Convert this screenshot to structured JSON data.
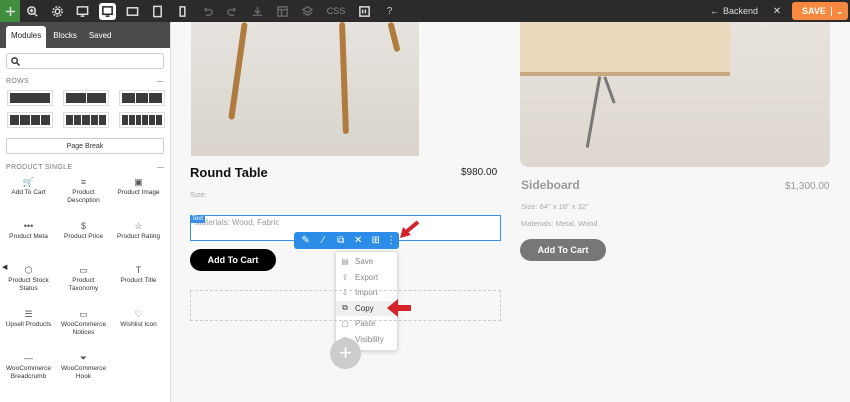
{
  "toolbar": {
    "icons": [
      "plus-icon",
      "zoom-icon",
      "gear-icon",
      "desktop-icon",
      "desktop-view-icon",
      "tablet-landscape-icon",
      "tablet-icon",
      "phone-icon",
      "undo-icon",
      "redo-icon",
      "download-icon",
      "layout-icon",
      "layers-icon"
    ],
    "css_label": "CSS",
    "backend_label": "Backend",
    "save_label": "SAVE",
    "accent": "#f6893f"
  },
  "panel": {
    "tabs": [
      "Modules",
      "Blocks",
      "Saved"
    ],
    "rows_title": "ROWS",
    "page_break": "Page Break",
    "product_title": "PRODUCT SINGLE",
    "modules": [
      {
        "label": "Add To Cart",
        "icon": "cart-icon"
      },
      {
        "label": "Product Description",
        "icon": "text-lines-icon"
      },
      {
        "label": "Product Image",
        "icon": "image-icon"
      },
      {
        "label": "Product Meta",
        "icon": "dots-icon"
      },
      {
        "label": "Product Price",
        "icon": "dollar-icon"
      },
      {
        "label": "Product Rating",
        "icon": "star-icon"
      },
      {
        "label": "Product Stock Status",
        "icon": "box-icon"
      },
      {
        "label": "Product Taxonomy",
        "icon": "comment-icon"
      },
      {
        "label": "Product Title",
        "icon": "title-icon"
      },
      {
        "label": "Upsell Products",
        "icon": "list-icon"
      },
      {
        "label": "WooCommerce Notices",
        "icon": "notice-icon"
      },
      {
        "label": "Wishlist Icon",
        "icon": "heart-icon"
      },
      {
        "label": "WooCommerce Breadcrumb",
        "icon": "breadcrumb-icon"
      },
      {
        "label": "WooCommerce Hook",
        "icon": "funnel-icon"
      }
    ]
  },
  "products": [
    {
      "title": "Round Table",
      "price": "$980.00",
      "size": "Size:",
      "materials": "Materials: Wood, Fabric",
      "button": "Add To Cart"
    },
    {
      "title": "Sideboard",
      "price": "$1,300.00",
      "size": "Size: 64\" x 18\" x 32\"",
      "materials": "Materials: Metal, Wood",
      "button": "Add To Cart"
    }
  ],
  "text_badge": "Text",
  "context_menu": [
    {
      "label": "Save",
      "icon": "save-icon"
    },
    {
      "label": "Export",
      "icon": "export-icon"
    },
    {
      "label": "Import",
      "icon": "import-icon"
    },
    {
      "label": "Copy",
      "icon": "copy-icon",
      "active": true
    },
    {
      "label": "Paste",
      "icon": "paste-icon"
    },
    {
      "label": "Visibility",
      "icon": "eye-icon"
    }
  ]
}
